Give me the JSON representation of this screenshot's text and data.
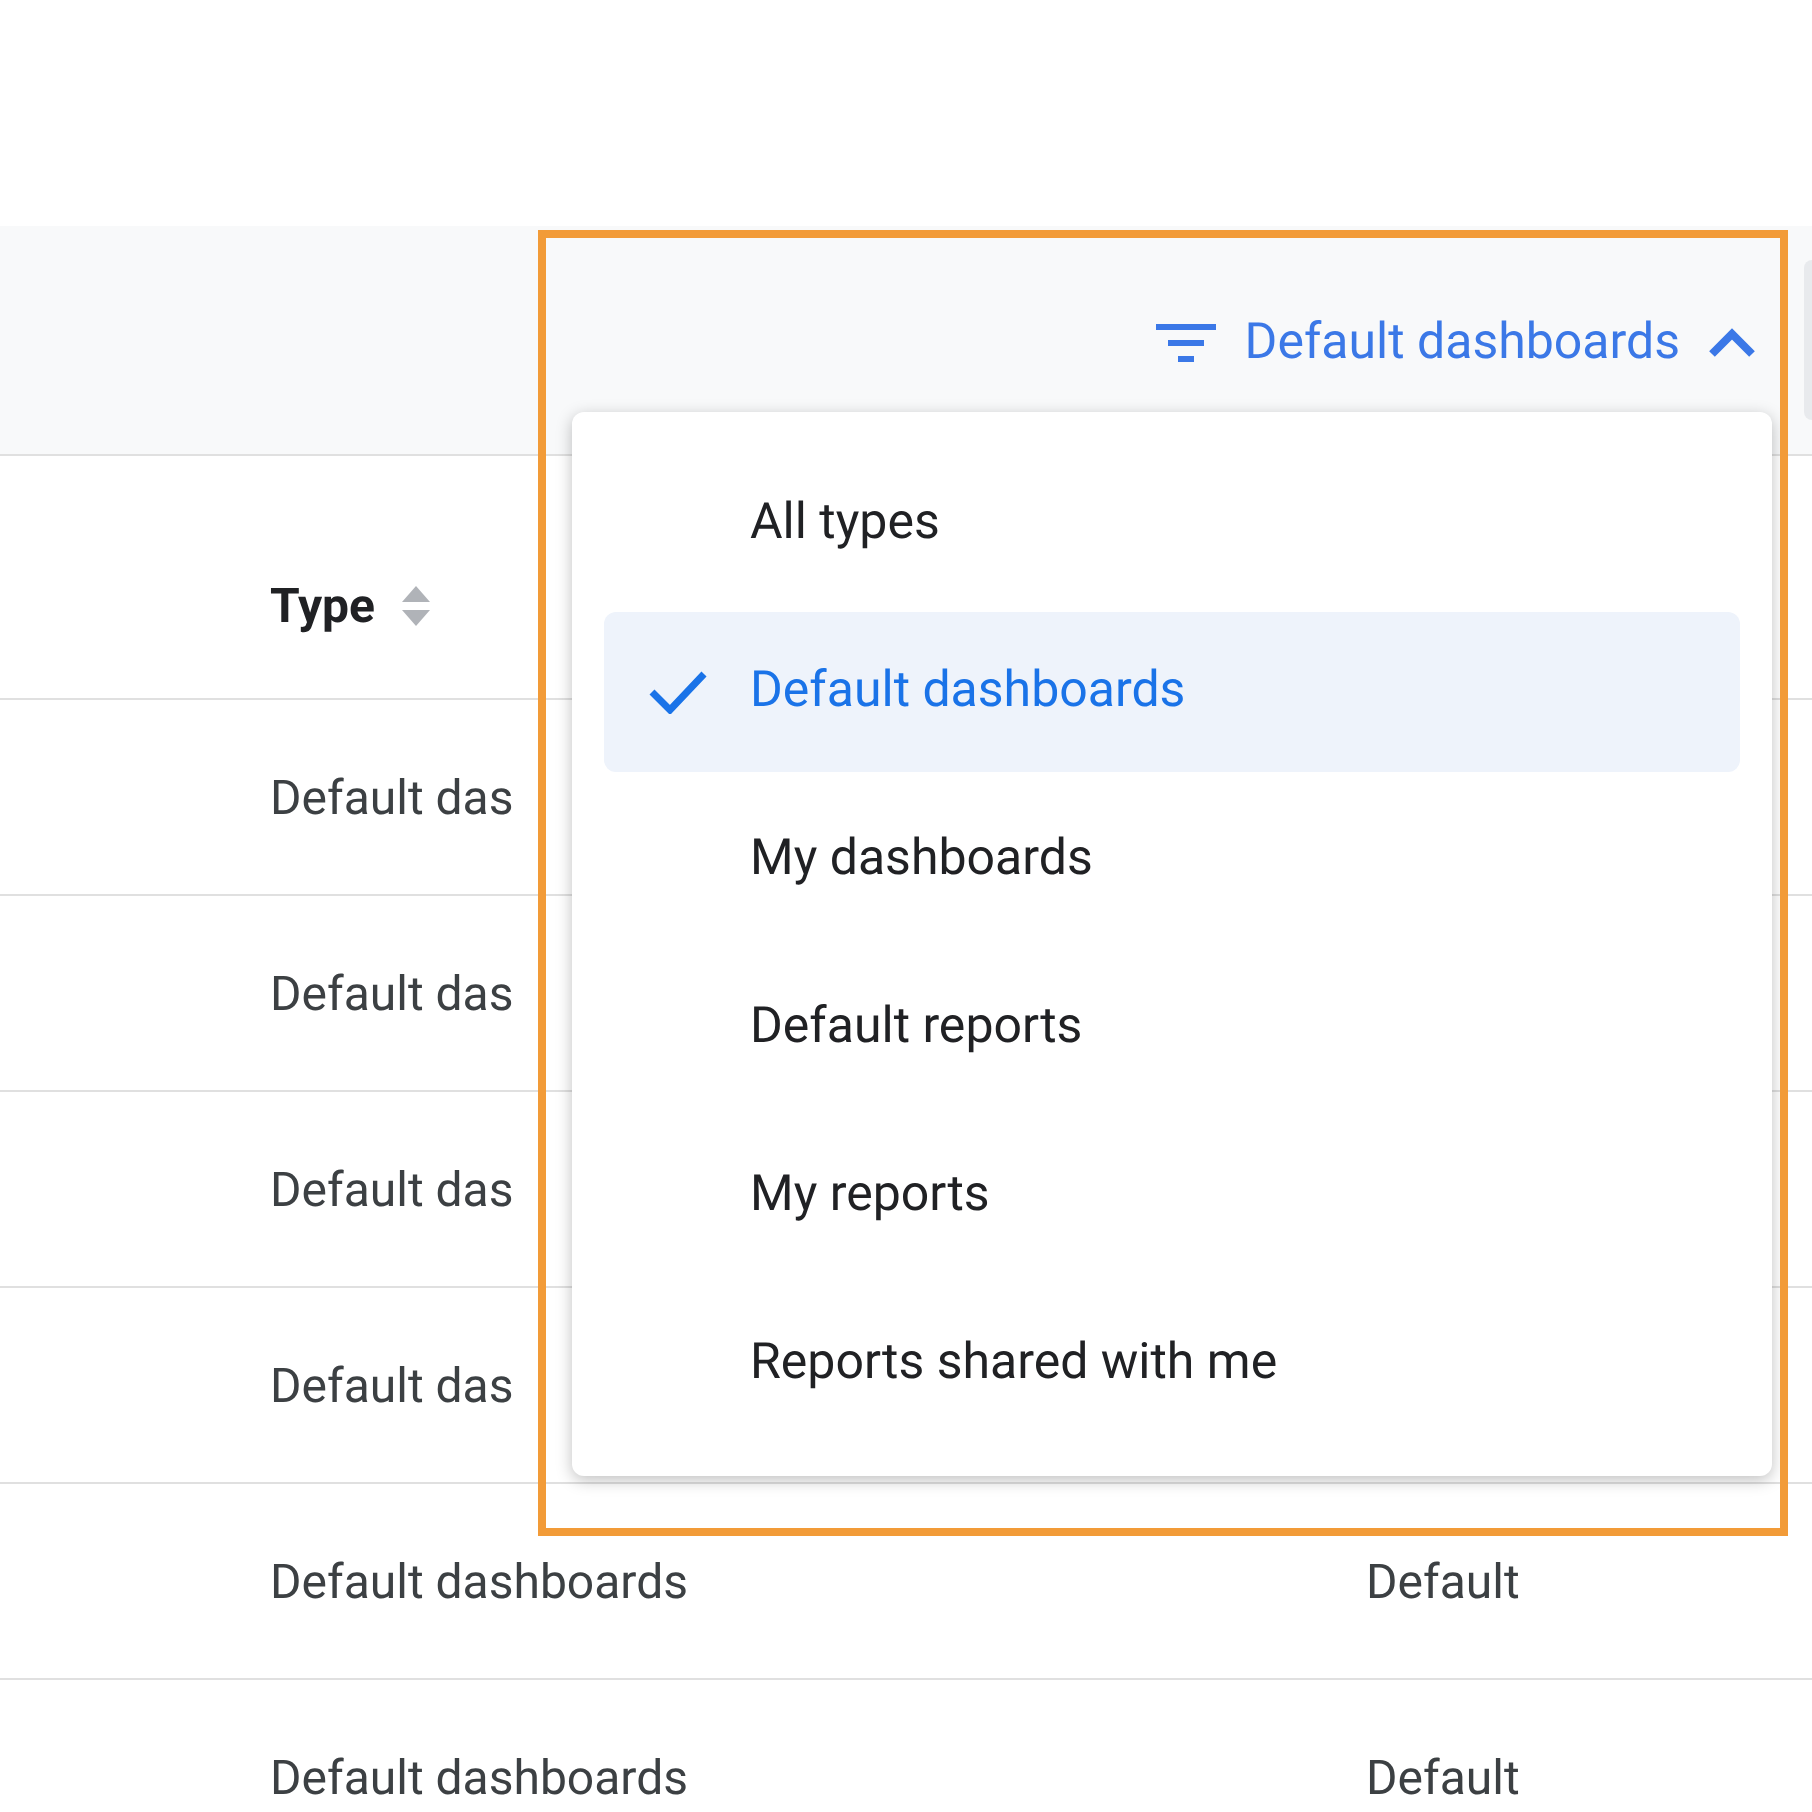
{
  "filter_button": {
    "label": "Default dashboards",
    "expanded": true
  },
  "table": {
    "columns": [
      {
        "label": "Type"
      }
    ],
    "rows": [
      {
        "column_1": "Default das"
      },
      {
        "column_1": "Default das"
      },
      {
        "column_1": "Default das"
      },
      {
        "column_1": "Default das"
      },
      {
        "column_1": "Default dashboards",
        "column_2": "Default"
      },
      {
        "column_1": "Default dashboards",
        "column_2": "Default"
      }
    ]
  },
  "dropdown": {
    "items": [
      {
        "label": "All types",
        "selected": false
      },
      {
        "label": "Default dashboards",
        "selected": true
      },
      {
        "label": "My dashboards",
        "selected": false
      },
      {
        "label": "Default reports",
        "selected": false
      },
      {
        "label": "My reports",
        "selected": false
      },
      {
        "label": "Reports shared with me",
        "selected": false
      }
    ]
  }
}
